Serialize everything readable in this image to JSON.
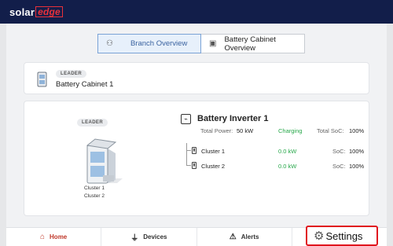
{
  "header": {
    "brand_part1": "solar",
    "brand_part2": "edge"
  },
  "tabs": [
    {
      "label": "Branch Overview",
      "icon": "branch-icon",
      "active": true
    },
    {
      "label": "Battery Cabinet Overview",
      "icon": "cabinet-icon",
      "active": false
    }
  ],
  "cabinet": {
    "badge": "LEADER",
    "name": "Battery Cabinet 1"
  },
  "overview": {
    "badge": "LEADER",
    "cluster_labels": [
      "Cluster 1",
      "Cluster 2"
    ],
    "inverter": {
      "title": "Battery Inverter 1",
      "total_power_label": "Total Power:",
      "total_power_value": "50 kW",
      "status": "Charging",
      "soc_label": "Total SoC:",
      "soc_value": "100%"
    },
    "clusters": [
      {
        "name": "Cluster 1",
        "power": "0.0 kW",
        "soc_label": "SoC:",
        "soc_value": "100%"
      },
      {
        "name": "Cluster 2",
        "power": "0.0 kW",
        "soc_label": "SoC:",
        "soc_value": "100%"
      }
    ]
  },
  "nav": {
    "home": "Home",
    "devices": "Devices",
    "alerts": "Alerts",
    "settings": "Settings"
  },
  "colors": {
    "topbar": "#121e4a",
    "brand_red": "#e8313b",
    "green": "#27a84a",
    "highlight": "#e0141e"
  }
}
